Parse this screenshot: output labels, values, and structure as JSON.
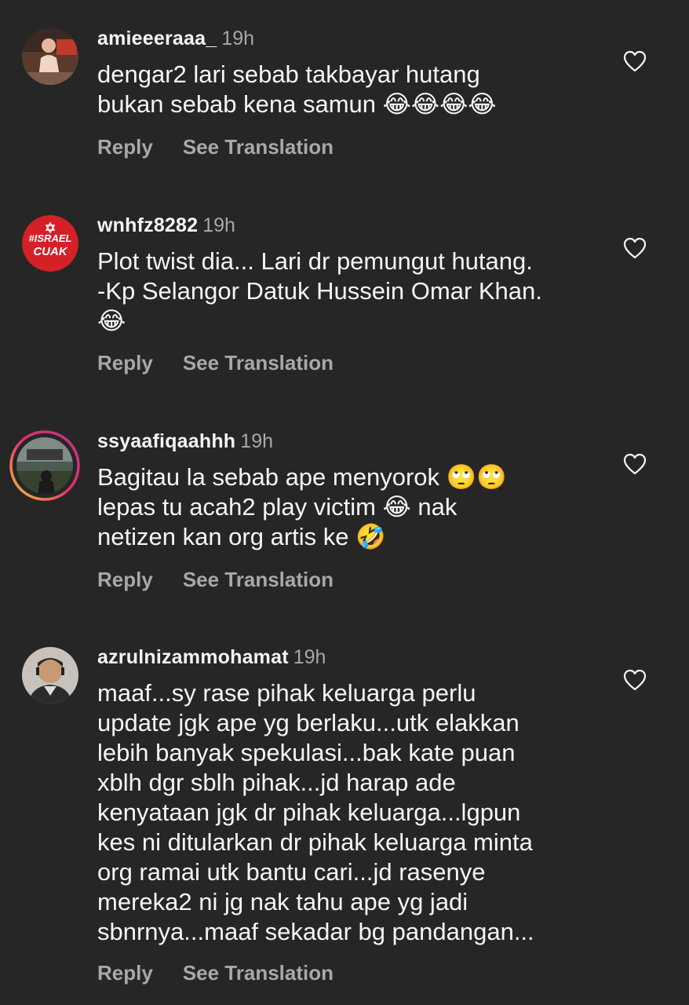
{
  "comments": [
    {
      "username": "amieeeraaa_",
      "time": "19h",
      "text": "dengar2 lari sebab takbayar hutang\nbukan sebab kena samun 😂😂😂😂",
      "reply_label": "Reply",
      "translate_label": "See Translation"
    },
    {
      "username": "wnhfz8282",
      "time": "19h",
      "avatar_text_1": "#ISRAEL",
      "avatar_text_2": "CUAK",
      "text": "Plot twist dia... Lari dr pemungut hutang.\n-Kp Selangor Datuk Hussein Omar Khan.\n😂",
      "reply_label": "Reply",
      "translate_label": "See Translation"
    },
    {
      "username": "ssyaafiqaahhh",
      "time": "19h",
      "text": "Bagitau la sebab ape menyorok 🙄🙄\nlepas tu acah2 play victim 😂 nak\nnetizen kan org artis ke 🤣",
      "reply_label": "Reply",
      "translate_label": "See Translation"
    },
    {
      "username": "azrulnizammohamat",
      "time": "19h",
      "text": "maaf...sy rase pihak keluarga perlu\nupdate jgk ape yg berlaku...utk elakkan\nlebih banyak spekulasi...bak kate puan\nxblh dgr sblh pihak...jd harap ade\nkenyataan jgk dr pihak keluarga...lgpun\nkes ni ditularkan dr pihak keluarga minta\norg ramai utk bantu cari...jd rasenye\nmereka2 ni jg nak tahu ape yg jadi\nsbnrnya...maaf sekadar bg pandangan...",
      "reply_label": "Reply",
      "translate_label": "See Translation"
    }
  ]
}
